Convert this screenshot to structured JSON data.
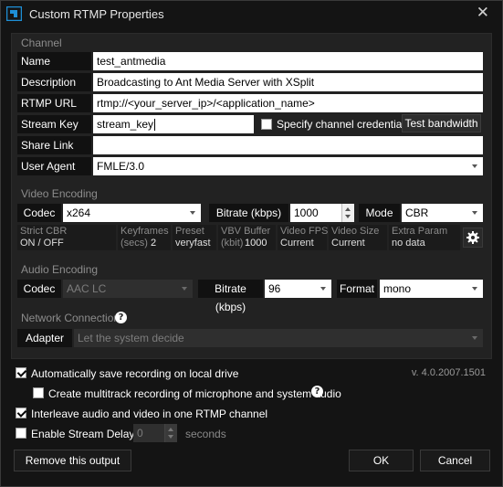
{
  "window": {
    "title": "Custom RTMP Properties"
  },
  "channel": {
    "section_title": "Channel",
    "name_label": "Name",
    "name_value": "test_antmedia",
    "description_label": "Description",
    "description_value": "Broadcasting to Ant Media Server with XSplit",
    "rtmp_label": "RTMP URL",
    "rtmp_value": "rtmp://<your_server_ip>/<application_name>",
    "stream_key_label": "Stream Key",
    "stream_key_value": "stream_key",
    "specify_credentials_label": "Specify channel credentials",
    "specify_credentials_checked": false,
    "test_bandwidth_label": "Test bandwidth",
    "share_link_label": "Share Link",
    "share_link_value": "",
    "user_agent_label": "User Agent",
    "user_agent_value": "FMLE/3.0"
  },
  "video": {
    "section_title": "Video Encoding",
    "codec_label": "Codec",
    "codec_value": "x264",
    "bitrate_label": "Bitrate (kbps)",
    "bitrate_value": "1000",
    "mode_label": "Mode",
    "mode_value": "CBR",
    "stats": {
      "strict_cbr_label": "Strict CBR",
      "strict_cbr_value": "ON / OFF",
      "keyframes_label1": "Keyframes",
      "keyframes_label2": "(secs)",
      "keyframes_value": "2",
      "preset_label": "Preset",
      "preset_value": "veryfast",
      "vbv_label": "VBV Buffer",
      "vbv_label2": "(kbit)",
      "vbv_value": "1000",
      "fps_label": "Video FPS",
      "fps_value": "Current",
      "size_label": "Video Size",
      "size_value": "Current",
      "extra_label": "Extra Param",
      "extra_value": "no data"
    }
  },
  "audio": {
    "section_title": "Audio Encoding",
    "codec_label": "Codec",
    "codec_value": "AAC LC",
    "bitrate_label": "Bitrate (kbps)",
    "bitrate_value": "96",
    "format_label": "Format",
    "format_value": "mono"
  },
  "network": {
    "section_title": "Network Connection",
    "adapter_label": "Adapter",
    "adapter_value": "Let the system decide"
  },
  "options": {
    "auto_save_label": "Automatically save recording on local drive",
    "auto_save_checked": true,
    "multitrack_label": "Create multitrack recording of microphone and system audio",
    "multitrack_checked": false,
    "interleave_label": "Interleave audio and video in one RTMP channel",
    "interleave_checked": true,
    "delay_label": "Enable Stream Delay",
    "delay_checked": false,
    "delay_value": "0",
    "delay_unit": "seconds"
  },
  "version": "v. 4.0.2007.1501",
  "buttons": {
    "remove": "Remove this output",
    "ok": "OK",
    "cancel": "Cancel"
  },
  "icons": {
    "app": "xsplit-logo-icon",
    "close": "close-icon",
    "help": "help-icon",
    "settings": "gear-icon"
  },
  "colors": {
    "background": "#141414",
    "panel": "#222222",
    "label_bg": "#111111",
    "section_text": "#8c8c8c"
  }
}
